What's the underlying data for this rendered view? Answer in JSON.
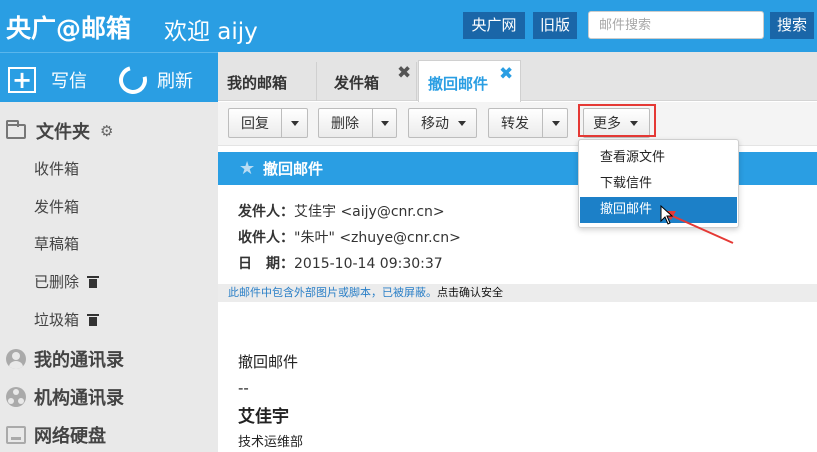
{
  "header": {
    "logo": "央广@邮箱",
    "welcome": "欢迎 aijy",
    "links": [
      "央广网",
      "旧版"
    ],
    "search_placeholder": "邮件搜索",
    "search_button": "搜索"
  },
  "sidebar": {
    "compose": "写信",
    "refresh": "刷新",
    "folders_title": "文件夹",
    "folders": [
      "收件箱",
      "发件箱",
      "草稿箱",
      "已删除",
      "垃圾箱"
    ],
    "sections": [
      "我的通讯录",
      "机构通讯录",
      "网络硬盘"
    ]
  },
  "tabs": [
    {
      "label": "我的邮箱"
    },
    {
      "label": "发件箱"
    },
    {
      "label": "撤回邮件"
    }
  ],
  "toolbar": {
    "reply": "回复",
    "delete": "删除",
    "move": "移动",
    "forward": "转发",
    "more": "更多"
  },
  "more_menu": [
    "查看源文件",
    "下载信件",
    "撤回邮件"
  ],
  "mail": {
    "subject": "撤回邮件",
    "from_label": "发件人：",
    "from": "艾佳宇 <aijy@cnr.cn>",
    "to_label": "收件人：",
    "to": "\"朱叶\" <zhuye@cnr.cn>",
    "date_label": "日　期：",
    "date": "2015-10-14 09:30:37",
    "warning": "此邮件中包含外部图片或脚本，已被屏蔽。",
    "warning_action": "点击确认安全",
    "body_line1": "撤回邮件",
    "body_sep": "--",
    "signature_name": "艾佳宇",
    "signature_dept": "技术运维部"
  },
  "colors": {
    "brand_blue": "#2a9ee3",
    "dark_blue": "#1a66a8",
    "menu_highlight": "#1c80c8",
    "annotation_red": "#e53935"
  }
}
